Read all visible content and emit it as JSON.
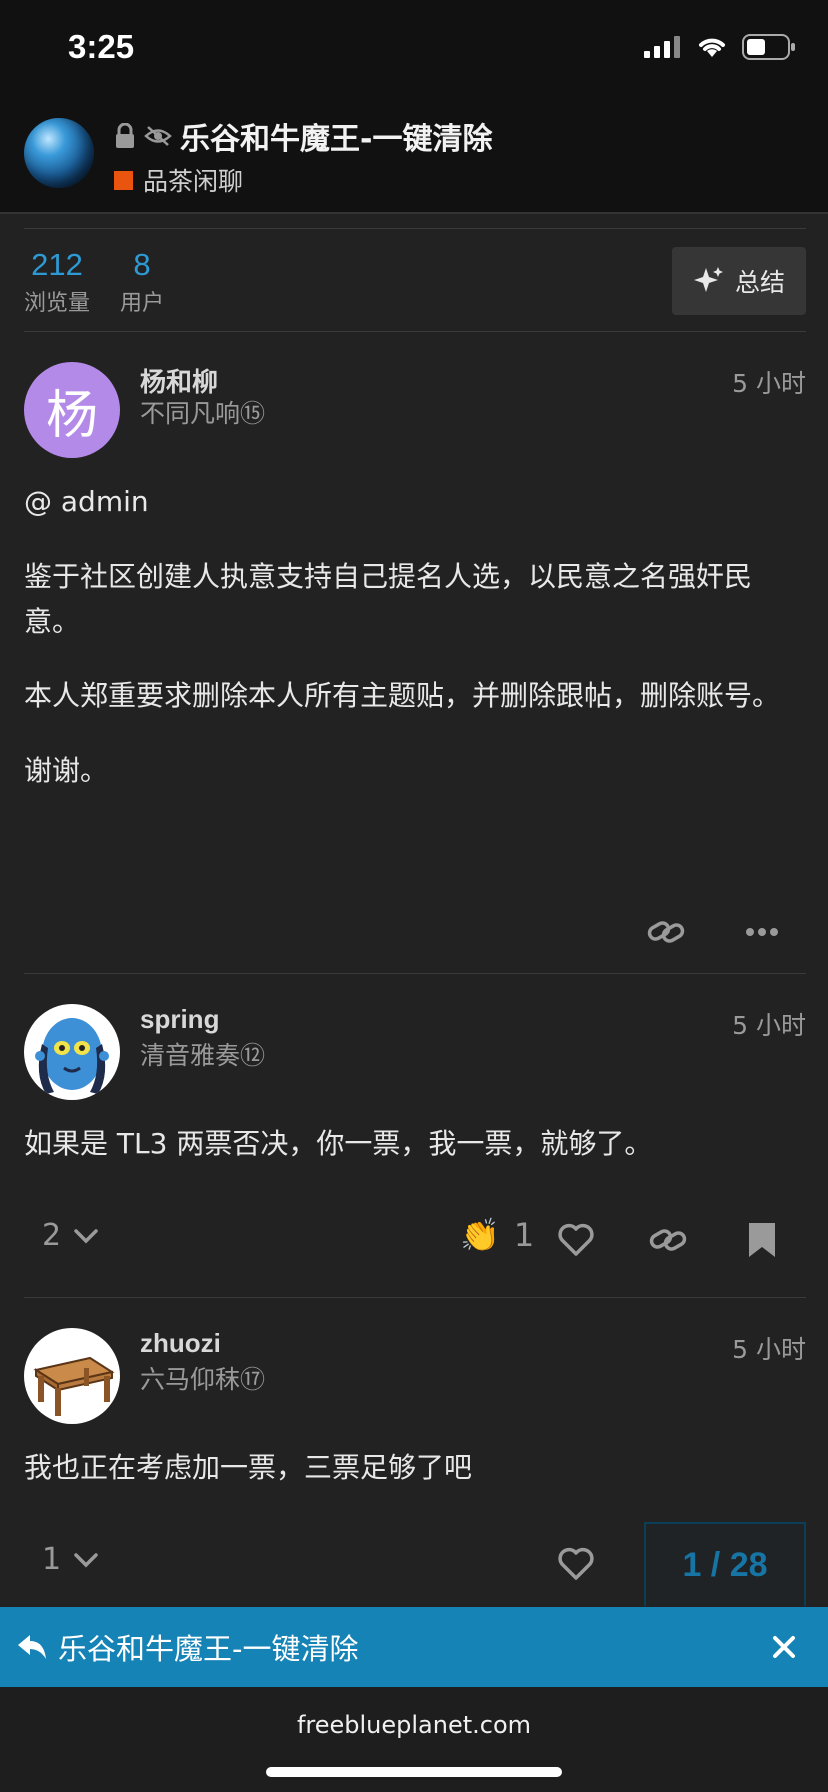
{
  "status_bar": {
    "time": "3:25"
  },
  "header": {
    "title": "乐谷和牛魔王-一键清除",
    "category": "品茶闲聊",
    "category_color": "#e9550f"
  },
  "stats": {
    "views_value": "212",
    "views_label": "浏览量",
    "users_value": "8",
    "users_label": "用户",
    "summary_label": "总结"
  },
  "posts": [
    {
      "avatar_letter": "杨",
      "avatar_color": "#b48ae8",
      "username": "杨和柳",
      "user_title": "不同凡响⑮",
      "time": "5 小时",
      "paragraphs": [
        "@ admin",
        "鉴于社区创建人执意支持自己提名人选，以民意之名强奸民意。",
        "本人郑重要求删除本人所有主题贴，并删除跟帖，删除账号。",
        "谢谢。"
      ]
    },
    {
      "username": "spring",
      "user_title": "清音雅奏⑫",
      "time": "5 小时",
      "paragraphs": [
        "如果是 TL3 两票否决，你一票，我一票，就够了。"
      ],
      "reply_count": "2",
      "reaction_emoji": "👏",
      "reaction_count": "1"
    },
    {
      "username": "zhuozi",
      "user_title": "六马仰秣⑰",
      "time": "5 小时",
      "paragraphs": [
        "我也正在考虑加一票，三票足够了吧"
      ],
      "reply_count": "1"
    }
  ],
  "progress": "1 / 28",
  "reply_banner": {
    "text": "乐谷和牛魔王-一键清除"
  },
  "browser": {
    "url": "freeblueplanet.com"
  },
  "colors": {
    "accent": "#2e9ad5",
    "banner": "#1583b5"
  }
}
